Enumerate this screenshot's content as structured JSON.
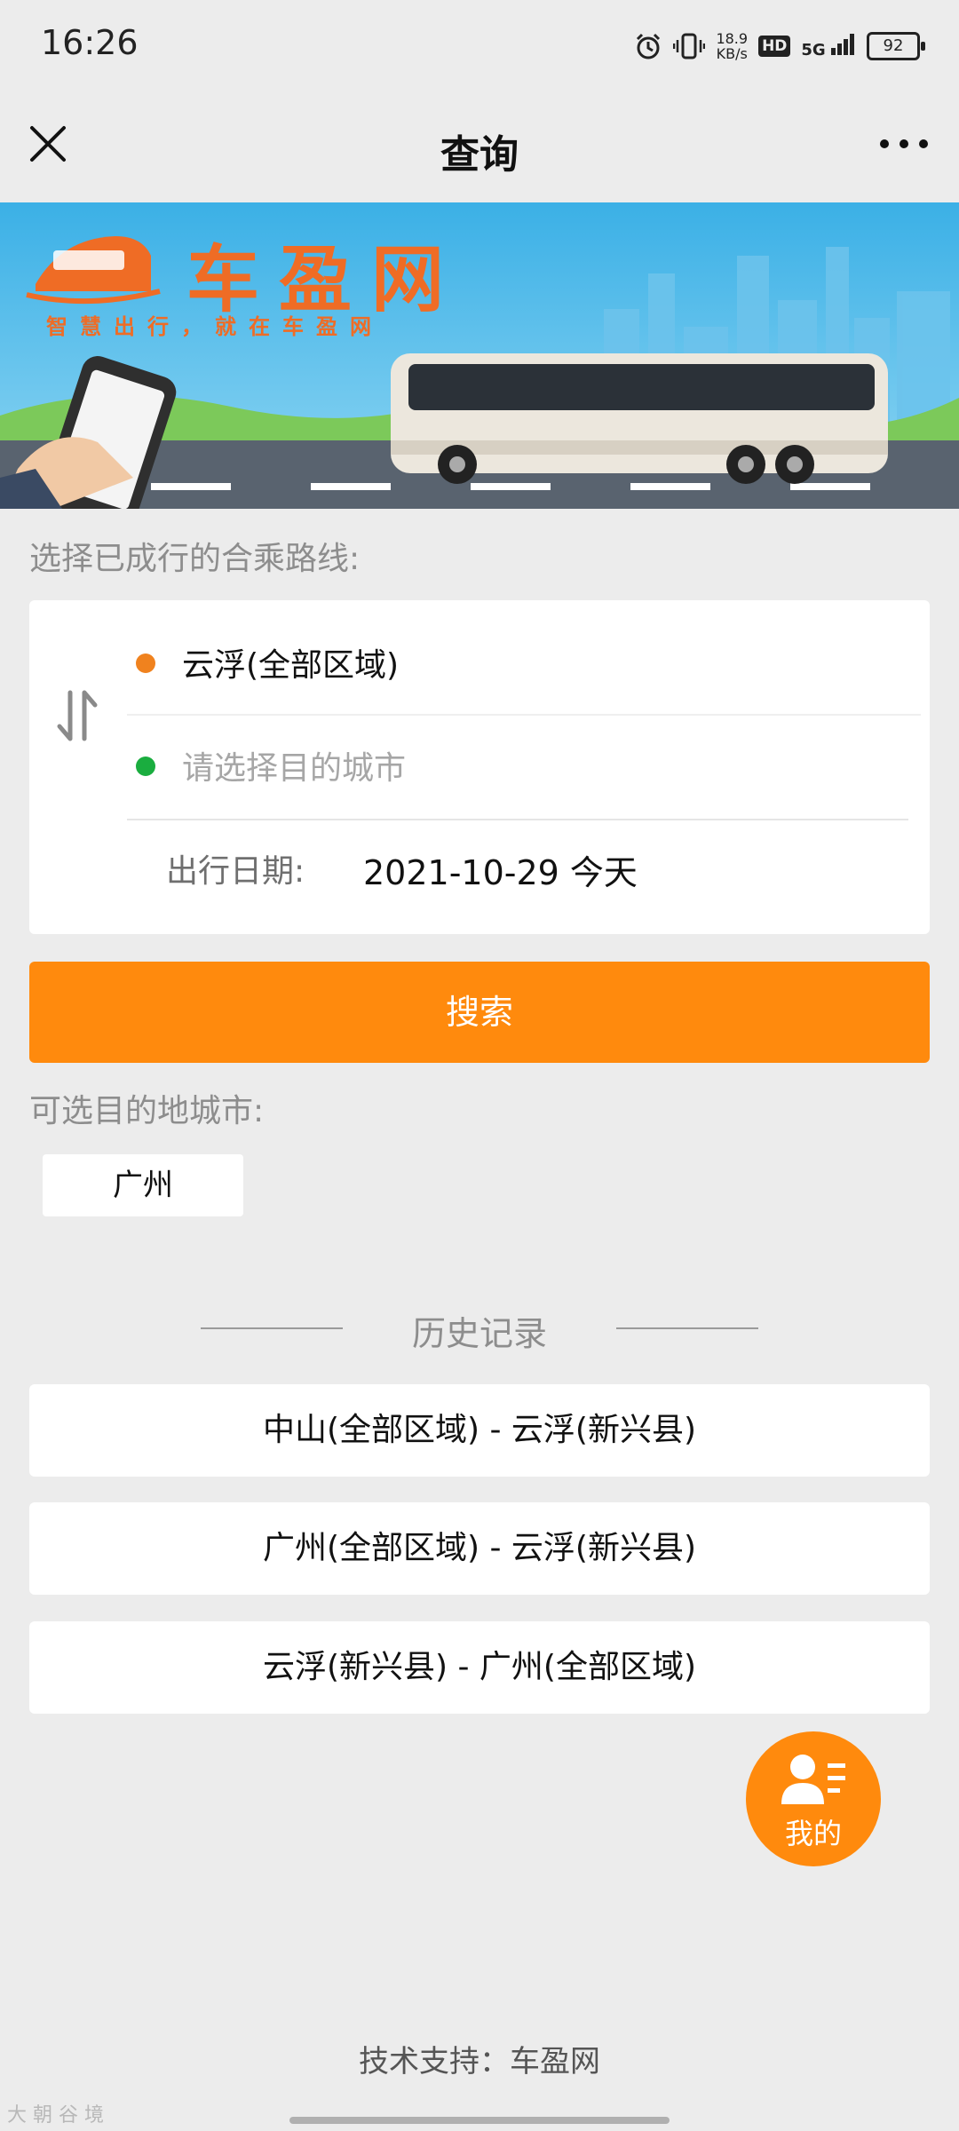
{
  "status_bar": {
    "time": "16:26",
    "net_speed_value": "18.9",
    "net_speed_unit": "KB/s",
    "hd_label": "HD",
    "signal_label": "5G",
    "battery_level": "92",
    "icons": [
      "alarm-icon",
      "vibrate-icon",
      "signal-icon",
      "battery-icon"
    ]
  },
  "navbar": {
    "title": "查询",
    "close_icon": "close-icon",
    "more_icon": "more-icon"
  },
  "banner": {
    "brand": "车盈网",
    "slogan": "智慧出行，就在车盈网"
  },
  "route_section": {
    "label": "选择已成行的合乘路线:",
    "from_city": "云浮(全部区域)",
    "to_placeholder": "请选择目的城市",
    "date_label": "出行日期:",
    "date_value": "2021-10-29 今天",
    "swap_icon": "swap-icon"
  },
  "search_button": "搜索",
  "destinations": {
    "label": "可选目的地城市:",
    "cities": [
      "广州"
    ]
  },
  "history": {
    "title": "历史记录",
    "items": [
      "中山(全部区域) - 云浮(新兴县)",
      "广州(全部区域) - 云浮(新兴县)",
      "云浮(新兴县) - 广州(全部区域)"
    ]
  },
  "me_button": "我的",
  "footer": "技术支持：车盈网",
  "watermark": "大 朝 谷 境",
  "colors": {
    "accent": "#ff8a0d",
    "from_dot": "#f0821e",
    "to_dot": "#1aad3f",
    "background": "#ececec"
  }
}
